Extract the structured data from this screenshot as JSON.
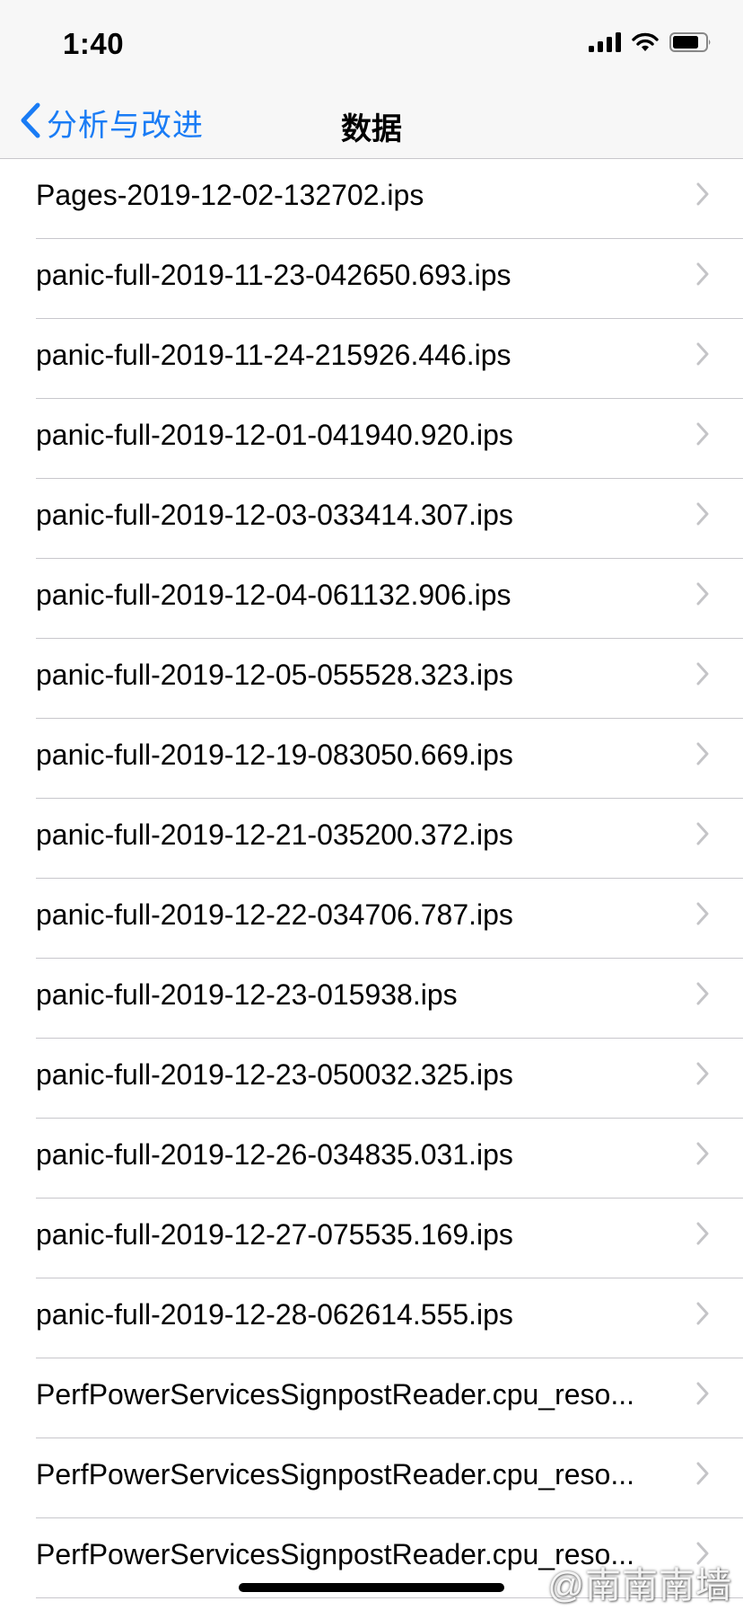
{
  "status_bar": {
    "time": "1:40",
    "icons": [
      "signal-icon",
      "wifi-icon",
      "battery-icon"
    ]
  },
  "nav": {
    "back_label": "分析与改进",
    "title": "数据"
  },
  "colors": {
    "accent": "#1a7cf5",
    "separator": "#c8c7cc",
    "chevron": "#c4c4c7",
    "bar_bg": "#f7f7f7"
  },
  "items": [
    {
      "label": "Pages-2019-12-02-132702.ips"
    },
    {
      "label": "panic-full-2019-11-23-042650.693.ips"
    },
    {
      "label": "panic-full-2019-11-24-215926.446.ips"
    },
    {
      "label": "panic-full-2019-12-01-041940.920.ips"
    },
    {
      "label": "panic-full-2019-12-03-033414.307.ips"
    },
    {
      "label": "panic-full-2019-12-04-061132.906.ips"
    },
    {
      "label": "panic-full-2019-12-05-055528.323.ips"
    },
    {
      "label": "panic-full-2019-12-19-083050.669.ips"
    },
    {
      "label": "panic-full-2019-12-21-035200.372.ips"
    },
    {
      "label": "panic-full-2019-12-22-034706.787.ips"
    },
    {
      "label": "panic-full-2019-12-23-015938.ips"
    },
    {
      "label": "panic-full-2019-12-23-050032.325.ips"
    },
    {
      "label": "panic-full-2019-12-26-034835.031.ips"
    },
    {
      "label": "panic-full-2019-12-27-075535.169.ips"
    },
    {
      "label": "panic-full-2019-12-28-062614.555.ips"
    },
    {
      "label": "PerfPowerServicesSignpostReader.cpu_reso..."
    },
    {
      "label": "PerfPowerServicesSignpostReader.cpu_reso..."
    },
    {
      "label": "PerfPowerServicesSignpostReader.cpu_reso..."
    }
  ],
  "watermark": {
    "text": "@南南南墙"
  }
}
